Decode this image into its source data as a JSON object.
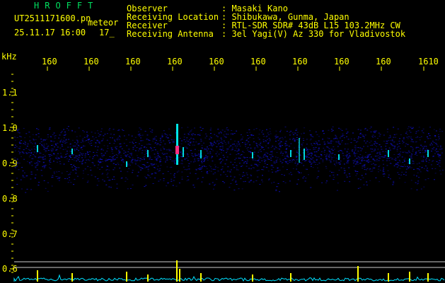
{
  "header": {
    "brand": "HROFFT",
    "filename": "UT2511171600.pn",
    "mode": "meteor",
    "datetime": "25.11.17 16:00",
    "minute_marker": "17_",
    "fields": [
      {
        "label": "Observer",
        "value": ": Masaki Kano"
      },
      {
        "label": "Receiving Location",
        "value": ": Shibukawa, Gunma, Japan"
      },
      {
        "label": "Receiver",
        "value": ": RTL-SDR SDR# 43dB L15 103.2MHz CW"
      },
      {
        "label": "Receiving Antenna",
        "value": ": 3el Yagi(V) Az 330 for Vladivostok"
      }
    ]
  },
  "axes": {
    "y_unit": "kHz",
    "y_ticks": [
      "1.1",
      "1.0",
      "0.9",
      "0.8",
      "0.7",
      "0.6"
    ],
    "x_ticks": [
      "160",
      "160",
      "160",
      "160",
      "160",
      "160",
      "160",
      "160",
      "160",
      "1610"
    ]
  },
  "colors": {
    "text": "#ffff00",
    "brand": "#00e060",
    "noise": "#1010c0",
    "signal": "#00ffff",
    "burst": "#ff3080",
    "trace": "#00e0ff"
  }
}
